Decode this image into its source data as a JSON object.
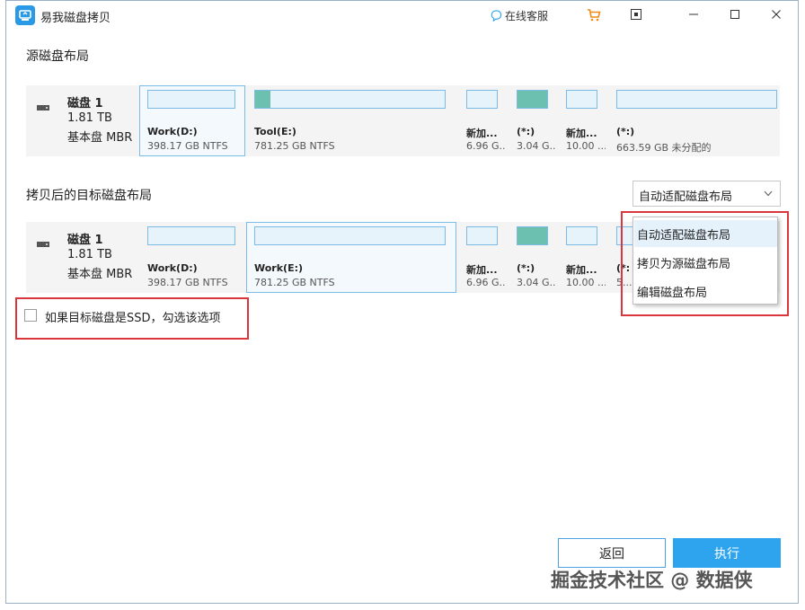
{
  "window": {
    "title": "易我磁盘拷贝"
  },
  "titlebar": {
    "support_label": "在线客服"
  },
  "source": {
    "section_title": "源磁盘布局",
    "disk": {
      "name": "磁盘 1",
      "size": "1.81 TB",
      "type": "基本盘 MBR"
    },
    "partitions": [
      {
        "label": "Work(D:)",
        "sub": "398.17 GB NTFS",
        "used": 0.0,
        "selected": true
      },
      {
        "label": "Tool(E:)",
        "sub": "781.25 GB NTFS",
        "used": 0.08,
        "selected": false
      },
      {
        "label": "新加...",
        "sub": "6.96 G...",
        "used": 0.0,
        "selected": false
      },
      {
        "label": "(*:)",
        "sub": "3.04 G...",
        "used": 1.0,
        "selected": false
      },
      {
        "label": "新加...",
        "sub": "10.00 ...",
        "used": 0.0,
        "selected": false
      },
      {
        "label": "(*:)",
        "sub": "663.59 GB 未分配的",
        "used": 0.0,
        "selected": false
      }
    ]
  },
  "target": {
    "section_title": "拷贝后的目标磁盘布局",
    "disk": {
      "name": "磁盘 1",
      "size": "1.81 TB",
      "type": "基本盘 MBR"
    },
    "partitions": [
      {
        "label": "Work(D:)",
        "sub": "398.17 GB NTFS",
        "used": 0.0,
        "selected": false
      },
      {
        "label": "Work(E:)",
        "sub": "781.25 GB NTFS",
        "used": 0.0,
        "selected": true
      },
      {
        "label": "新加...",
        "sub": "6.96 G...",
        "used": 0.0,
        "selected": false
      },
      {
        "label": "(*:)",
        "sub": "3.04 G...",
        "used": 1.0,
        "selected": false
      },
      {
        "label": "新加...",
        "sub": "10.00 ...",
        "used": 0.0,
        "selected": false
      },
      {
        "label": "(*:",
        "sub": "5...",
        "used": 0.0,
        "selected": false
      }
    ]
  },
  "layout_select": {
    "value": "自动适配磁盘布局",
    "options": [
      "自动适配磁盘布局",
      "拷贝为源磁盘布局",
      "编辑磁盘布局"
    ]
  },
  "ssd_option": {
    "label": "如果目标磁盘是SSD，勾选该选项",
    "checked": false
  },
  "buttons": {
    "back": "返回",
    "execute": "执行"
  },
  "watermark": "掘金技术社区 @ 数据侠",
  "colors": {
    "accent": "#2fa4ee",
    "partition_used": "#6cc0b0",
    "highlight_box": "#d9373b"
  }
}
